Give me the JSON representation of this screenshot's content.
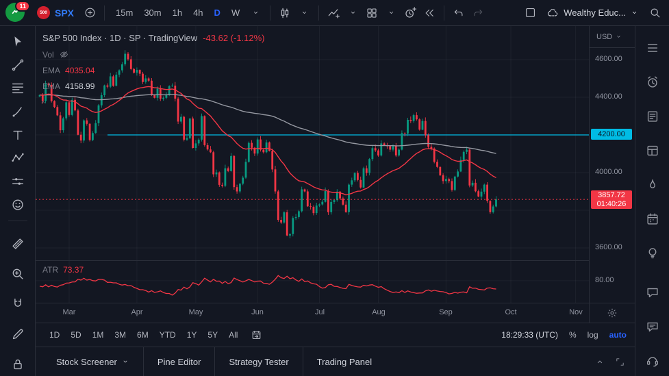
{
  "topbar": {
    "notification_count": "11",
    "symbol": "SPX",
    "symbol_logo": "500",
    "timeframes": [
      {
        "label": "15m"
      },
      {
        "label": "30m"
      },
      {
        "label": "1h"
      },
      {
        "label": "4h"
      },
      {
        "label": "D",
        "active": true
      },
      {
        "label": "W"
      }
    ],
    "layout_name": "Wealthy Educ..."
  },
  "left_toolbar": {
    "tools": [
      {
        "name": "cursor",
        "icon": "cursor"
      },
      {
        "name": "trend-line",
        "icon": "trend"
      },
      {
        "name": "fib-retracement",
        "icon": "fib"
      },
      {
        "name": "brush",
        "icon": "brush"
      },
      {
        "name": "text",
        "icon": "text"
      },
      {
        "name": "xabcd-pattern",
        "icon": "xabcd"
      },
      {
        "name": "long-short-position",
        "icon": "position"
      },
      {
        "name": "emoji",
        "icon": "emoji"
      },
      {
        "divider": true
      },
      {
        "name": "measure",
        "icon": "measure",
        "gap": true
      },
      {
        "name": "zoom-in",
        "icon": "zoom",
        "gap": true
      },
      {
        "name": "magnet",
        "icon": "magnet",
        "gap": true
      },
      {
        "name": "draw",
        "icon": "draw",
        "gap": true
      },
      {
        "name": "lock-all-drawings",
        "icon": "lock",
        "gap": true
      }
    ]
  },
  "right_toolbar": {
    "top": [
      {
        "name": "watchlist",
        "icon": "watchlist"
      },
      {
        "name": "alerts",
        "icon": "alarm"
      },
      {
        "name": "news",
        "icon": "news"
      },
      {
        "name": "data-window",
        "icon": "datawin"
      },
      {
        "name": "hotlists",
        "icon": "hot"
      },
      {
        "name": "calendar",
        "icon": "cal"
      },
      {
        "name": "ideas",
        "icon": "idea"
      }
    ],
    "bottom": [
      {
        "name": "private-chats",
        "icon": "chat"
      },
      {
        "name": "public-chats",
        "icon": "chat2"
      },
      {
        "name": "support",
        "icon": "support"
      }
    ]
  },
  "chart": {
    "legend": {
      "title": "S&P 500 Index · 1D · SP  · TradingView",
      "change": "-43.62 (-1.12%)",
      "vol_label": "Vol",
      "ema1_label": "EMA",
      "ema1_value": "4035.04",
      "ema2_label": "EMA",
      "ema2_value": "4158.99",
      "atr_label": "ATR",
      "atr_value": "73.37"
    },
    "price_axis": {
      "currency": "USD",
      "labels": [
        {
          "text": "4600.00",
          "p": 4600
        },
        {
          "text": "4400.00",
          "p": 4400
        },
        {
          "text": "4000.00",
          "p": 4000
        },
        {
          "text": "3600.00",
          "p": 3600
        }
      ],
      "hline_label": "4200.00",
      "hline_p": 4200,
      "last_price": "3857.72",
      "countdown": "01:40:26",
      "last_p": 3857.72,
      "atr_value_label": "80.00",
      "atr_p": 80
    }
  },
  "chart_data": {
    "type": "candlestick",
    "title": "S&P 500 Index",
    "interval": "1D",
    "last_price": 3857.72,
    "change": "-43.62 (-1.12%)",
    "hline_level": 4200,
    "price_axis_ticks": [
      4600,
      4400,
      4200,
      4000,
      3800,
      3600
    ],
    "visible_price_range": [
      3560,
      4760
    ],
    "months": [
      {
        "label": "Mar",
        "i": 10
      },
      {
        "label": "Apr",
        "i": 33
      },
      {
        "label": "May",
        "i": 53
      },
      {
        "label": "Jun",
        "i": 74
      },
      {
        "label": "Jul",
        "i": 95
      },
      {
        "label": "Aug",
        "i": 115
      },
      {
        "label": "Sep",
        "i": 138
      },
      {
        "label": "Oct",
        "i": 160
      },
      {
        "label": "Nov",
        "i": 182
      }
    ],
    "closes": [
      4412,
      4380,
      4471,
      4465,
      4380,
      4348,
      4304,
      4225,
      4288,
      4373,
      4306,
      4386,
      4330,
      4201,
      4170,
      4277,
      4259,
      4173,
      4210,
      4262,
      4357,
      4411,
      4463,
      4456,
      4511,
      4461,
      4520,
      4543,
      4575,
      4631,
      4602,
      4550,
      4530,
      4545,
      4525,
      4481,
      4500,
      4488,
      4412,
      4397,
      4446,
      4392,
      4397,
      4412,
      4459,
      4462,
      4393,
      4271,
      4296,
      4175,
      4183,
      4287,
      4131,
      4155,
      4175,
      4300,
      4146,
      4123,
      4108,
      3991,
      4001,
      3935,
      3930,
      4023,
      4008,
      4088,
      3923,
      3900,
      3941,
      3973,
      4057,
      4158,
      4132,
      4101,
      4176,
      4121,
      4108,
      4160,
      4115,
      4017,
      3900,
      3749,
      3735,
      3789,
      3666,
      3674,
      3759,
      3764,
      3795,
      3911,
      3900,
      3821,
      3818,
      3785,
      3825,
      3831,
      3845,
      3902,
      3790,
      3844,
      3854,
      3899,
      3863,
      3830,
      3790,
      3936,
      3959,
      3998,
      3961,
      3921,
      4023,
      3998,
      4072,
      4130,
      4118,
      4091,
      4155,
      4145,
      4140,
      4122,
      4140,
      4091,
      4122,
      4210,
      4207,
      4280,
      4274,
      4305,
      4283,
      4228,
      4274,
      4199,
      4137,
      4128,
      4057,
      4030,
      3986,
      3955,
      3966,
      3955,
      3908,
      3979,
      4006,
      4067,
      4110,
      4122,
      3932,
      3946,
      3901,
      3873,
      3899,
      3936,
      3850,
      3790,
      3820,
      3858
    ],
    "indicators": [
      {
        "name": "EMA",
        "period": 30,
        "color": "#f23645",
        "last_value": 4035.04
      },
      {
        "name": "EMA",
        "period": 150,
        "color": "#9598a1",
        "last_value": 4158.99
      },
      {
        "name": "ATR",
        "period": 14,
        "pane": "lower",
        "color": "#f23645",
        "last_value": 73.37,
        "axis_tick": 80,
        "value_range": [
          45,
          110
        ]
      }
    ],
    "colors": {
      "up": "#089981",
      "down": "#f23645",
      "hline": "#00bce5",
      "ma": "#9598a1"
    }
  },
  "range_bar": {
    "ranges": [
      "1D",
      "5D",
      "1M",
      "3M",
      "6M",
      "YTD",
      "1Y",
      "5Y",
      "All"
    ],
    "clock": "18:29:33 (UTC)",
    "percent": "%",
    "log": "log",
    "auto": "auto"
  },
  "bottom_panel": {
    "tabs": [
      {
        "label": "Stock Screener",
        "caret": true
      },
      {
        "label": "Pine Editor"
      },
      {
        "label": "Strategy Tester"
      },
      {
        "label": "Trading Panel"
      }
    ]
  }
}
